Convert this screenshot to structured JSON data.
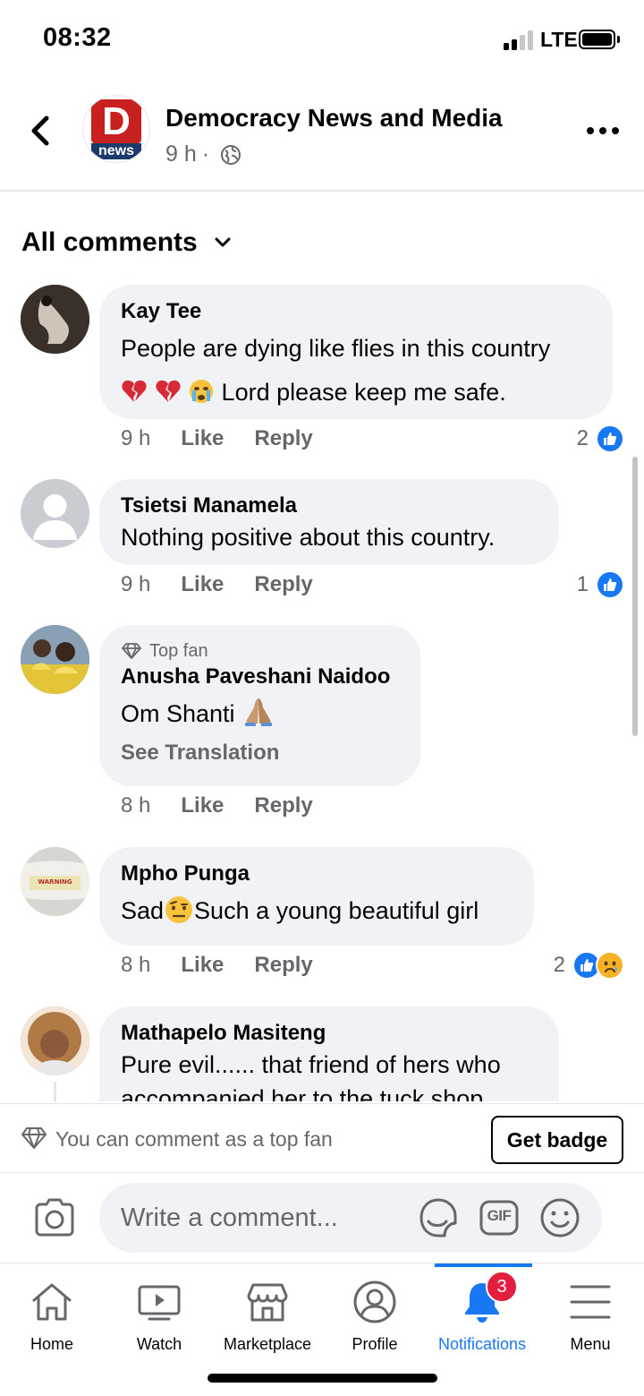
{
  "status_bar": {
    "time": "08:32",
    "network": "LTE"
  },
  "header": {
    "page_name": "Democracy News and Media",
    "time": "9 h",
    "separator": "·",
    "logo_letter": "D",
    "logo_text": "news"
  },
  "sort": {
    "label": "All comments"
  },
  "comments": [
    {
      "name": "Kay Tee",
      "lines": [
        "People are dying like flies in this country",
        "Lord please keep me safe."
      ],
      "time": "9 h",
      "like": "Like",
      "reply": "Reply",
      "reaction_count": "2"
    },
    {
      "name": "Tsietsi Manamela",
      "lines": [
        "Nothing positive about this country."
      ],
      "time": "9 h",
      "like": "Like",
      "reply": "Reply",
      "reaction_count": "1"
    },
    {
      "badge": "Top fan",
      "name": "Anusha Paveshani Naidoo",
      "lines": [
        "Om Shanti"
      ],
      "see_translation": "See Translation",
      "time": "8 h",
      "like": "Like",
      "reply": "Reply"
    },
    {
      "name": "Mpho Punga",
      "text_before": "Sad",
      "text_after": "Such a young beautiful girl",
      "time": "8 h",
      "like": "Like",
      "reply": "Reply",
      "reaction_count": "2"
    },
    {
      "name": "Mathapelo Masiteng",
      "lines": [
        "Pure evil...... that friend of hers who",
        "accompanied her to the tuck shop"
      ]
    }
  ],
  "topfan_bar": {
    "message": "You can comment as a top fan",
    "button": "Get badge"
  },
  "composer": {
    "placeholder": "Write a comment...",
    "gif_label": "GIF"
  },
  "nav": {
    "items": [
      {
        "label": "Home",
        "icon": "home-icon"
      },
      {
        "label": "Watch",
        "icon": "watch-icon"
      },
      {
        "label": "Marketplace",
        "icon": "marketplace-icon"
      },
      {
        "label": "Profile",
        "icon": "profile-icon"
      },
      {
        "label": "Notifications",
        "icon": "bell-icon",
        "badge": "3",
        "active": true
      },
      {
        "label": "Menu",
        "icon": "menu-icon"
      }
    ]
  },
  "colors": {
    "accent": "#1877f2",
    "bubble": "#f0f2f5",
    "secondary_text": "#65676b",
    "badge_red": "#e41e3f"
  }
}
